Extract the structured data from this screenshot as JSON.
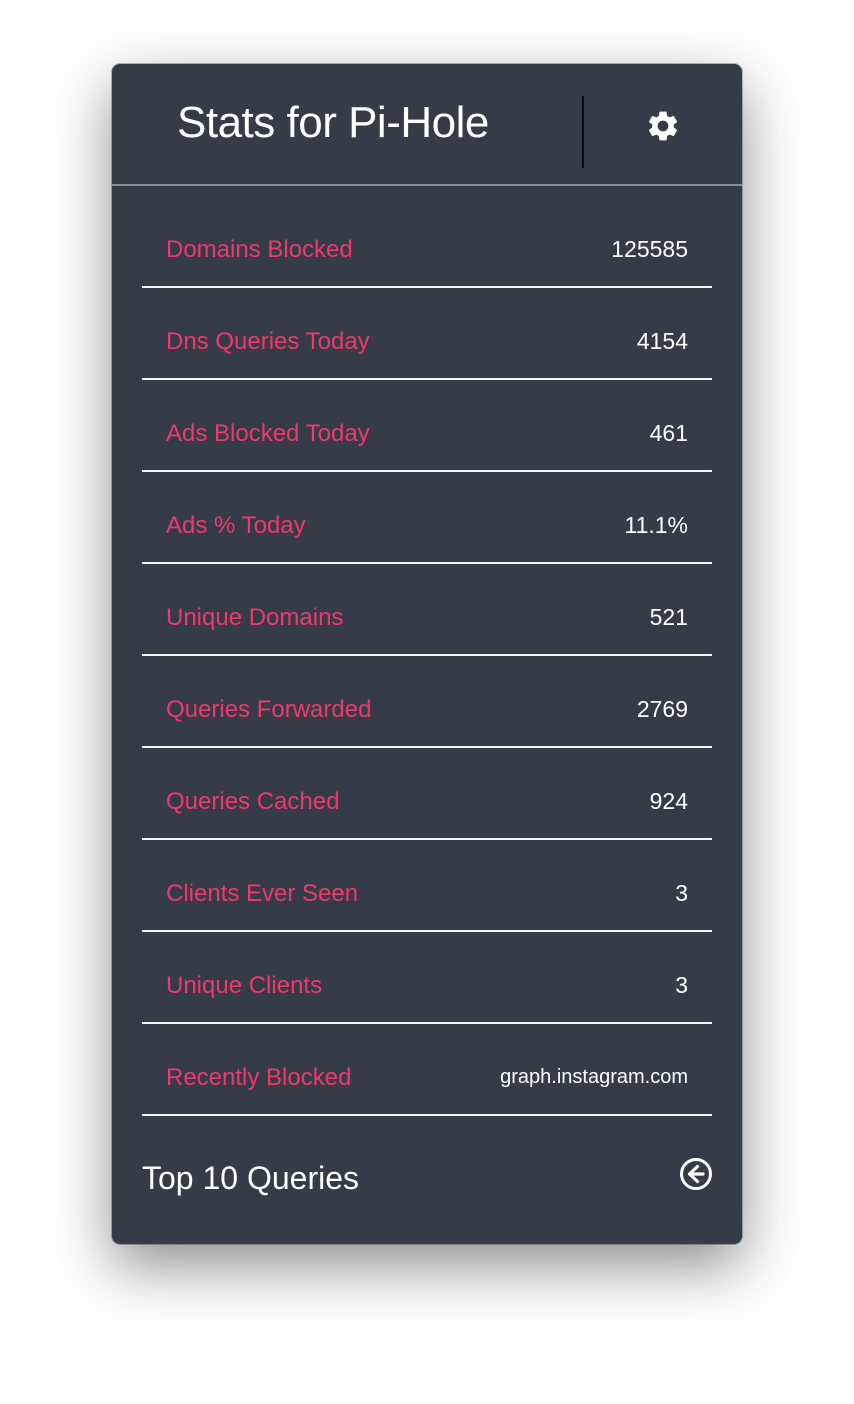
{
  "header": {
    "title": "Stats for Pi-Hole",
    "settings_icon": "gear-icon"
  },
  "stats": [
    {
      "label": "Domains Blocked",
      "value": "125585"
    },
    {
      "label": "Dns Queries Today",
      "value": "4154"
    },
    {
      "label": "Ads Blocked Today",
      "value": "461"
    },
    {
      "label": "Ads % Today",
      "value": "11.1%"
    },
    {
      "label": "Unique Domains",
      "value": "521"
    },
    {
      "label": "Queries Forwarded",
      "value": "2769"
    },
    {
      "label": "Queries Cached",
      "value": "924"
    },
    {
      "label": "Clients Ever Seen",
      "value": "3"
    },
    {
      "label": "Unique Clients",
      "value": "3"
    },
    {
      "label": "Recently Blocked",
      "value": "graph.instagram.com"
    }
  ],
  "footer": {
    "label": "Top 10 Queries",
    "icon": "arrow-circle-left-icon"
  },
  "colors": {
    "background": "#363c47",
    "label": "#f0386b",
    "value": "#ffffff"
  }
}
